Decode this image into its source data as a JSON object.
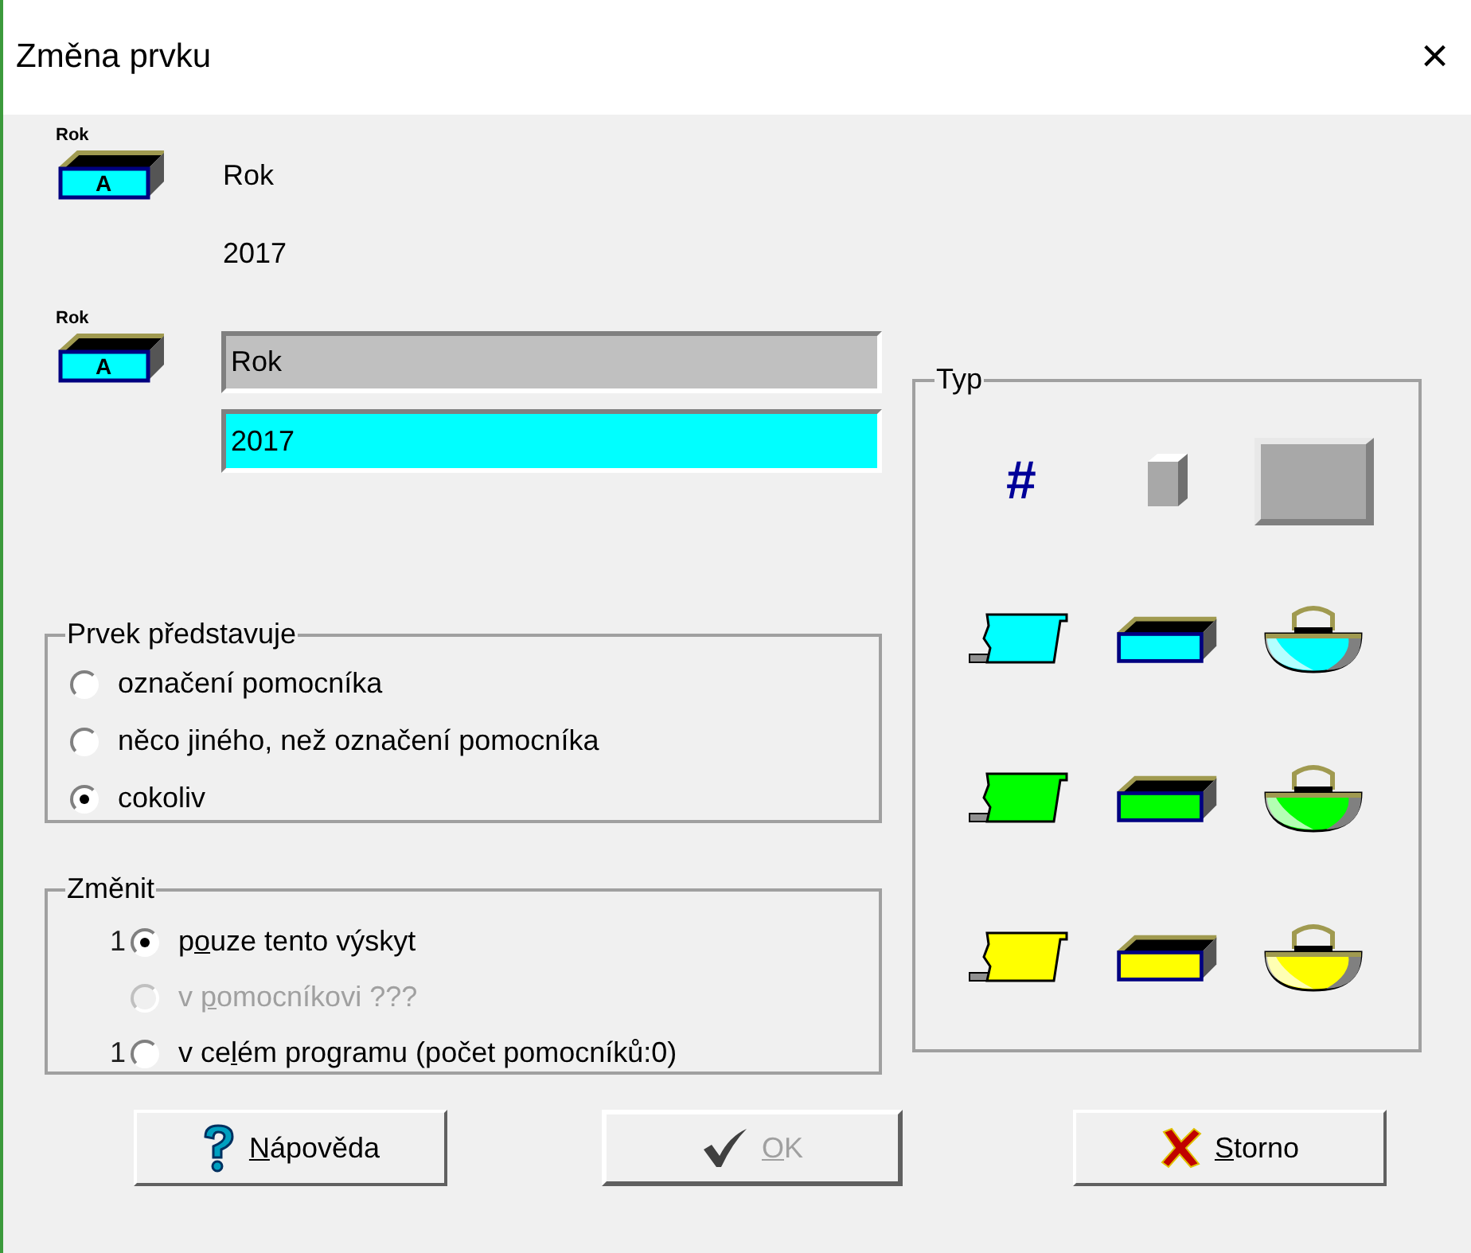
{
  "window": {
    "title": "Změna prvku",
    "close": "×"
  },
  "element": {
    "icon_caption": "Rok",
    "icon_letter": "A",
    "name": "Rok",
    "value": "2017"
  },
  "edit": {
    "icon_caption": "Rok",
    "icon_letter": "A",
    "name_field": "Rok",
    "value_field": "2017"
  },
  "represents": {
    "title": "Prvek představuje",
    "options": [
      {
        "label": "označení pomocníka",
        "selected": false
      },
      {
        "label": "něco jiného, než označení pomocníka",
        "selected": false
      },
      {
        "label": "cokoliv",
        "selected": true
      }
    ]
  },
  "change": {
    "title": "Změnit",
    "options": [
      {
        "count": "1",
        "label_before": "p",
        "access_key": "o",
        "label_after": "uze tento výskyt",
        "selected": true,
        "disabled": false
      },
      {
        "label_before": "v ",
        "access_key": "p",
        "label_after": "omocníkovi ???",
        "selected": false,
        "disabled": true
      },
      {
        "count": "1",
        "label_before": "v ce",
        "access_key": "l",
        "label_after": "ém programu (počet pomocníků:0)",
        "selected": false,
        "disabled": false
      }
    ]
  },
  "type": {
    "title": "Typ",
    "items": [
      {
        "kind": "hash",
        "symbol": "#"
      },
      {
        "kind": "cube"
      },
      {
        "kind": "panel"
      },
      {
        "kind": "paper",
        "color": "#00ffff"
      },
      {
        "kind": "box",
        "color": "#00ffff"
      },
      {
        "kind": "basket",
        "color": "#00ffff"
      },
      {
        "kind": "paper",
        "color": "#00ff00"
      },
      {
        "kind": "box",
        "color": "#00ff00"
      },
      {
        "kind": "basket",
        "color": "#00ff00"
      },
      {
        "kind": "paper",
        "color": "#ffff00"
      },
      {
        "kind": "box",
        "color": "#ffff00"
      },
      {
        "kind": "basket",
        "color": "#ffff00"
      }
    ]
  },
  "buttons": [
    {
      "kind": "help",
      "access_key": "N",
      "label_after": "ápověda",
      "disabled": false
    },
    {
      "kind": "ok",
      "access_key": "O",
      "label_after": "K",
      "disabled": true
    },
    {
      "kind": "cancel",
      "access_key": "S",
      "label_after": "torno",
      "disabled": false
    }
  ]
}
